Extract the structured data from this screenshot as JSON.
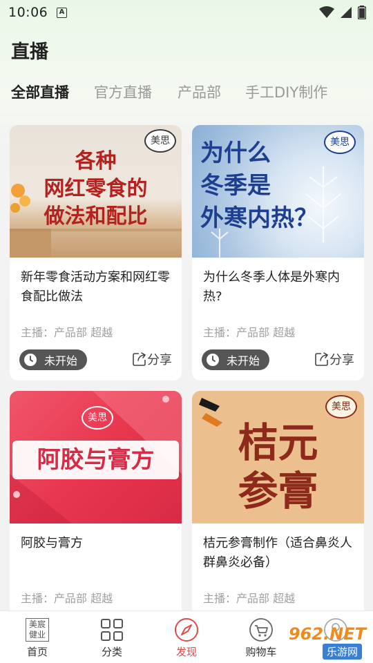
{
  "status_bar": {
    "time": "10:06",
    "notification_badge": "A"
  },
  "page": {
    "title": "直播"
  },
  "tabs": [
    {
      "label": "全部直播",
      "active": true
    },
    {
      "label": "官方直播",
      "active": false
    },
    {
      "label": "产品部",
      "active": false
    },
    {
      "label": "手工DIY制作",
      "active": false
    }
  ],
  "cards": [
    {
      "thumb_lines": [
        "各种",
        "网红零食的",
        "做法和配比"
      ],
      "title": "新年零食活动方案和网红零食配比做法",
      "host": "主播：产品部 超越",
      "status": "未开始",
      "share": "分享"
    },
    {
      "thumb_lines": [
        "为什么",
        "冬季是",
        "外寒内热？"
      ],
      "title": "为什么冬季人体是外寒内热?",
      "host": "主播：产品部 超越",
      "status": "未开始",
      "share": "分享"
    },
    {
      "thumb_lines": [
        "阿胶与膏方"
      ],
      "title": "阿胶与膏方",
      "host": "主播：产品部 超越"
    },
    {
      "thumb_lines": [
        "桔元",
        "参膏"
      ],
      "title": "桔元参膏制作（适合鼻炎人群鼻炎必备）",
      "host": "主播：产品部 超越"
    }
  ],
  "bottom_nav": [
    {
      "label": "首页",
      "icon": "brand-logo-icon",
      "active": false
    },
    {
      "label": "分类",
      "icon": "grid-icon",
      "active": false
    },
    {
      "label": "发现",
      "icon": "compass-icon",
      "active": true
    },
    {
      "label": "购物车",
      "icon": "cart-icon",
      "active": false
    },
    {
      "label": "",
      "icon": "profile-icon",
      "active": false
    }
  ],
  "brand": {
    "logo_text": "美思",
    "home_logo_text": "美宸健业"
  },
  "watermark": {
    "text": "962.NET",
    "subtext": "乐游网"
  },
  "colors": {
    "accent": "#e04a4a",
    "pill": "#555555",
    "thumb_red_text": "#b3221f",
    "thumb_blue_text": "#1e3f8f"
  }
}
